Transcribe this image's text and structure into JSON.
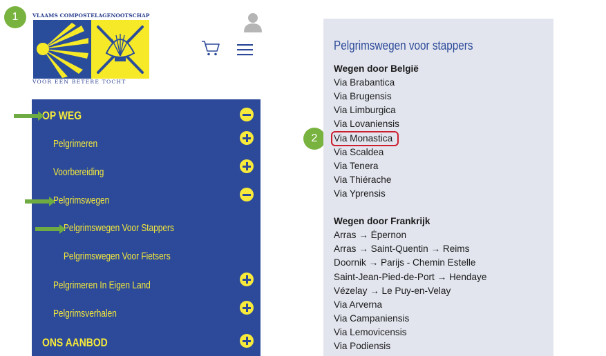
{
  "badges": [
    "1",
    "2"
  ],
  "logo": {
    "top_text": "VLAAMS COMPOSTELAGENOOTSCHAP",
    "bottom_text": "VOOR EEN BETERE TOCHT",
    "colors": {
      "blue": "#2a4d9b",
      "yellow": "#f6e927"
    }
  },
  "header_icons": [
    "user-icon",
    "cart-icon",
    "menu-icon"
  ],
  "nav": {
    "background": "#2c4a99",
    "text_color": "#f7ea3a",
    "items": [
      {
        "label": "OP WEG",
        "toggle": "minus"
      },
      {
        "label": "Pelgrimeren",
        "toggle": "plus"
      },
      {
        "label": "Voorbereiding",
        "toggle": "plus"
      },
      {
        "label": "Pelgrimswegen",
        "toggle": "minus"
      },
      {
        "label": "Pelgrimswegen Voor Stappers",
        "toggle": ""
      },
      {
        "label": "Pelgrimswegen Voor Fietsers",
        "toggle": ""
      },
      {
        "label": "Pelgrimeren In Eigen Land",
        "toggle": "plus"
      },
      {
        "label": "Pelgrimsverhalen",
        "toggle": "plus"
      },
      {
        "label": "ONS AANBOD",
        "toggle": "plus"
      }
    ]
  },
  "panel": {
    "title": "Pelgrimswegen voor stappers",
    "sections": [
      {
        "heading": "Wegen door België",
        "links": [
          "Via Brabantica",
          "Via Brugensis",
          "Via Limburgica",
          "Via Lovaniensis",
          "Via Monastica",
          "Via Scaldea",
          "Via Tenera",
          "Via Thiérache",
          "Via Yprensis"
        ]
      },
      {
        "heading": "Wegen door Frankrijk",
        "links": [
          "Arras → Épernon",
          "Arras → Saint-Quentin → Reims",
          "Doornik → Parijs - Chemin Estelle",
          "Saint-Jean-Pied-de-Port → Hendaye",
          "Vézelay → Le Puy-en-Velay",
          "Via Arverna",
          "Via Campaniensis",
          "Via Lemovicensis",
          "Via Podiensis"
        ]
      }
    ]
  },
  "colors": {
    "badge": "#79b33f",
    "arrow": "#6eab43",
    "highlight": "#cc1f2f"
  }
}
